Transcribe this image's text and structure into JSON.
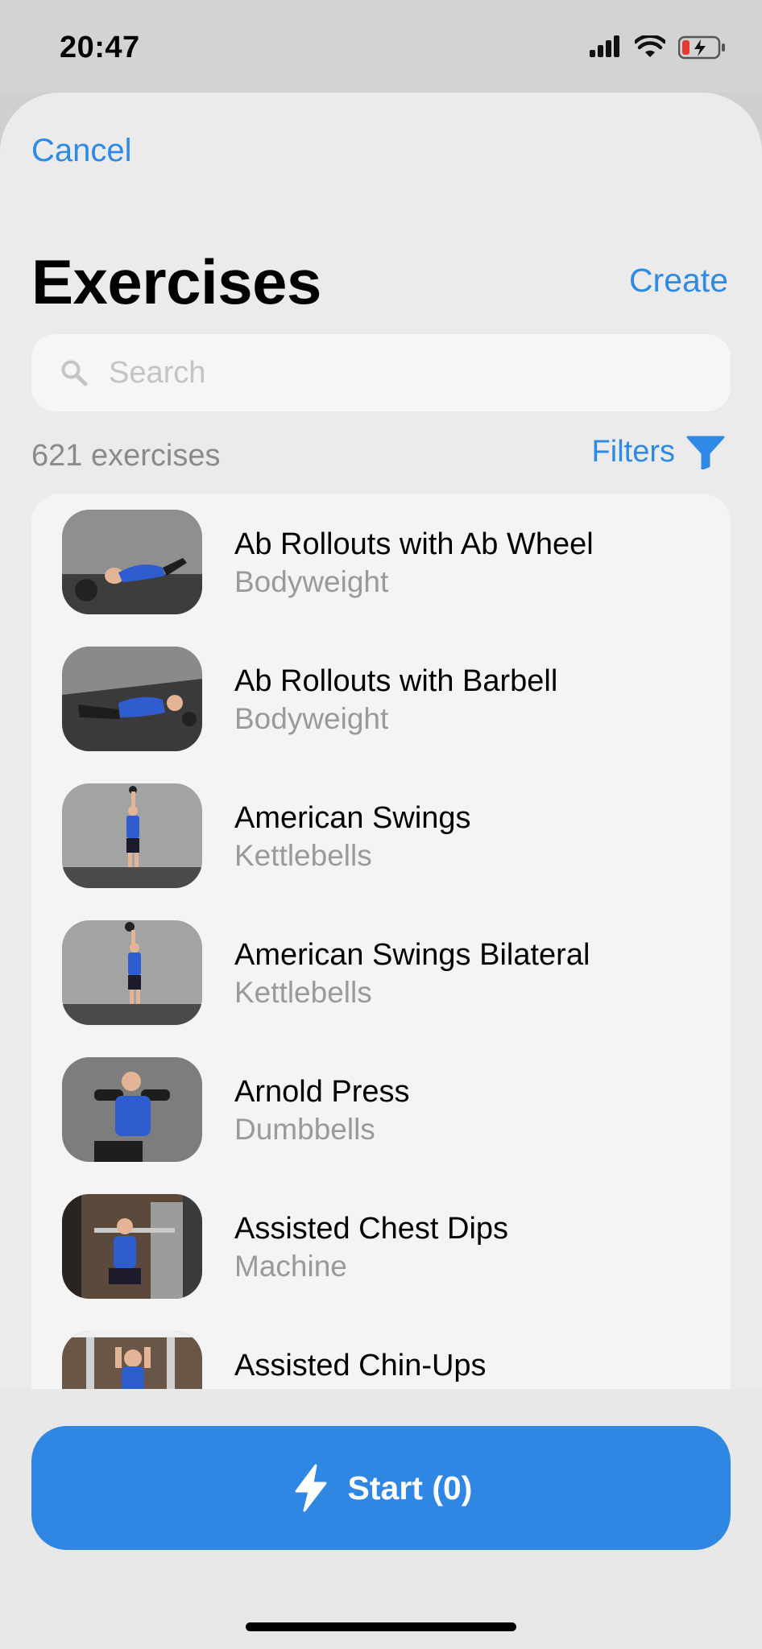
{
  "status": {
    "time": "20:47"
  },
  "header": {
    "cancel": "Cancel",
    "title": "Exercises",
    "create": "Create"
  },
  "search": {
    "placeholder": "Search",
    "value": ""
  },
  "list_meta": {
    "count": "621 exercises",
    "filters": "Filters"
  },
  "exercises": [
    {
      "name": "Ab Rollouts with Ab Wheel",
      "category": "Bodyweight"
    },
    {
      "name": "Ab Rollouts with Barbell",
      "category": "Bodyweight"
    },
    {
      "name": "American Swings",
      "category": "Kettlebells"
    },
    {
      "name": "American Swings Bilateral",
      "category": "Kettlebells"
    },
    {
      "name": "Arnold Press",
      "category": "Dumbbells"
    },
    {
      "name": "Assisted Chest Dips",
      "category": "Machine"
    },
    {
      "name": "Assisted Chin-Ups",
      "category": ""
    }
  ],
  "footer": {
    "start": "Start (0)"
  },
  "colors": {
    "accent": "#2f8ae6",
    "button": "#2f86e3"
  }
}
